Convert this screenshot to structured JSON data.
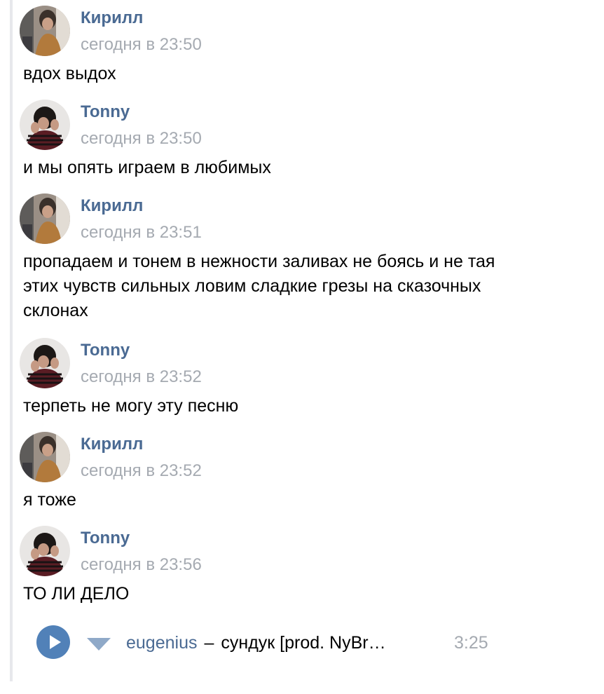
{
  "messages": [
    {
      "author": "Кирилл",
      "time": "сегодня в 23:50",
      "avatar": "kirill-avatar",
      "lines": [
        "вдох выдох"
      ]
    },
    {
      "author": "Tonny",
      "time": "сегодня в 23:50",
      "avatar": "tonny-avatar",
      "lines": [
        "и мы опять играем в любимых"
      ]
    },
    {
      "author": "Кирилл",
      "time": "сегодня в 23:51",
      "avatar": "kirill-avatar",
      "lines": [
        "пропадаем и тонем в нежности заливах не боясь и не тая",
        "этих чувств сильных ловим сладкие грезы на сказочных",
        "склонах"
      ]
    },
    {
      "author": "Tonny",
      "time": "сегодня в 23:52",
      "avatar": "tonny-avatar",
      "lines": [
        "терпеть не могу эту песню"
      ]
    },
    {
      "author": "Кирилл",
      "time": "сегодня в 23:52",
      "avatar": "kirill-avatar",
      "lines": [
        "я тоже"
      ]
    },
    {
      "author": "Tonny",
      "time": "сегодня в 23:56",
      "avatar": "tonny-avatar",
      "lines": [
        "ТО ЛИ ДЕЛО"
      ]
    }
  ],
  "audio": {
    "artist": "eugenius",
    "separator": "–",
    "title": "сундук [prod. NyBr…",
    "duration": "3:25",
    "play_icon": "play-icon",
    "more_icon": "chevron-down-icon"
  },
  "colors": {
    "author": "#4a6a93",
    "time": "#a5aab1",
    "accent": "#5181b8",
    "thread_bar": "#e7e8ec"
  }
}
